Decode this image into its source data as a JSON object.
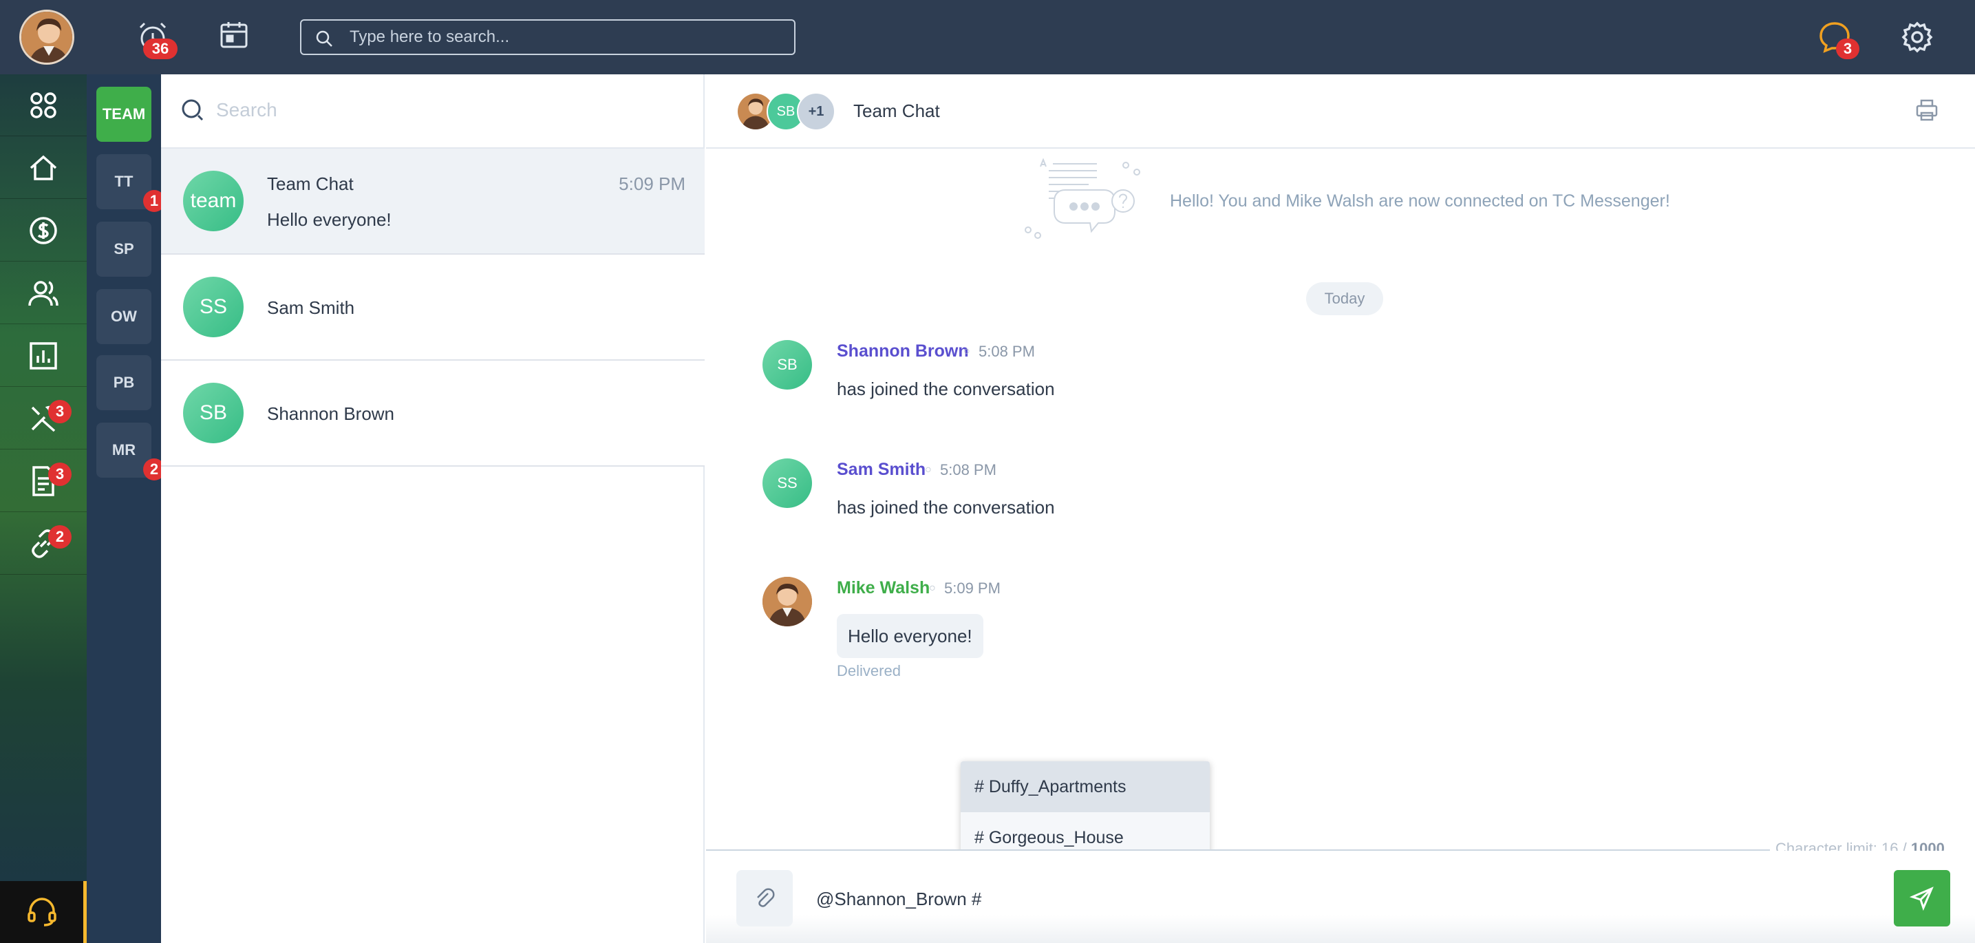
{
  "topbar": {
    "search_placeholder": "Type here to search...",
    "alarm_badge": "36",
    "chat_badge": "3",
    "icons": [
      "user-avatar",
      "alarm-clock-icon",
      "calendar-icon",
      "search-icon",
      "chat-bubble-icon",
      "gear-icon"
    ]
  },
  "leftnav": {
    "items": [
      {
        "name": "dashboard",
        "icon": "grid-icon",
        "badge": ""
      },
      {
        "name": "home",
        "icon": "home-icon",
        "badge": ""
      },
      {
        "name": "billing",
        "icon": "dollar-icon",
        "badge": ""
      },
      {
        "name": "contacts",
        "icon": "users-icon",
        "badge": ""
      },
      {
        "name": "reports",
        "icon": "chart-icon",
        "badge": ""
      },
      {
        "name": "tools",
        "icon": "tools-icon",
        "badge": "3"
      },
      {
        "name": "documents",
        "icon": "document-icon",
        "badge": "3"
      },
      {
        "name": "links",
        "icon": "link-icon",
        "badge": "2"
      }
    ],
    "support_icon": "headset-icon"
  },
  "groups": [
    {
      "label": "TEAM",
      "badge": "",
      "active": true
    },
    {
      "label": "TT",
      "badge": "1"
    },
    {
      "label": "SP",
      "badge": ""
    },
    {
      "label": "OW",
      "badge": ""
    },
    {
      "label": "PB",
      "badge": ""
    },
    {
      "label": "MR",
      "badge": "2"
    }
  ],
  "chatlist": {
    "search_placeholder": "Search",
    "items": [
      {
        "avatar": "team",
        "name": "Team Chat",
        "time": "5:09 PM",
        "preview": "Hello everyone!"
      },
      {
        "avatar": "SS",
        "name": "Sam Smith",
        "time": "",
        "preview": ""
      },
      {
        "avatar": "SB",
        "name": "Shannon Brown",
        "time": "",
        "preview": ""
      }
    ]
  },
  "conversation": {
    "header": {
      "avatars": [
        "SB",
        "+1"
      ],
      "title": "Team Chat"
    },
    "welcome": "Hello! You and Mike Walsh are now connected on TC Messenger!",
    "date_divider": "Today",
    "messages": [
      {
        "avatar": "SB",
        "name": "Shannon Brown",
        "time": "5:08 PM",
        "text": "has joined the conversation",
        "color": "#5a4fcf"
      },
      {
        "avatar": "SS",
        "name": "Sam Smith",
        "time": "5:08 PM",
        "text": "has joined the conversation",
        "color": "#5a4fcf"
      },
      {
        "avatar": "photo",
        "name": "Mike Walsh",
        "time": "5:09 PM",
        "text": "Hello everyone!",
        "status": "Delivered",
        "color": "#3fae4a"
      }
    ],
    "suggestions": [
      "# Duffy_Apartments",
      "# Gorgeous_House"
    ],
    "char_limit_label": "Character limit: 16 /",
    "char_limit_max": "1000",
    "composer_value": "@Shannon_Brown #"
  },
  "colors": {
    "topbar": "#2e3d52",
    "accent_green": "#3fae4a",
    "badge_red": "#e03131",
    "name_purple": "#5a4fcf",
    "avatar_teal": "#4cc99a"
  }
}
